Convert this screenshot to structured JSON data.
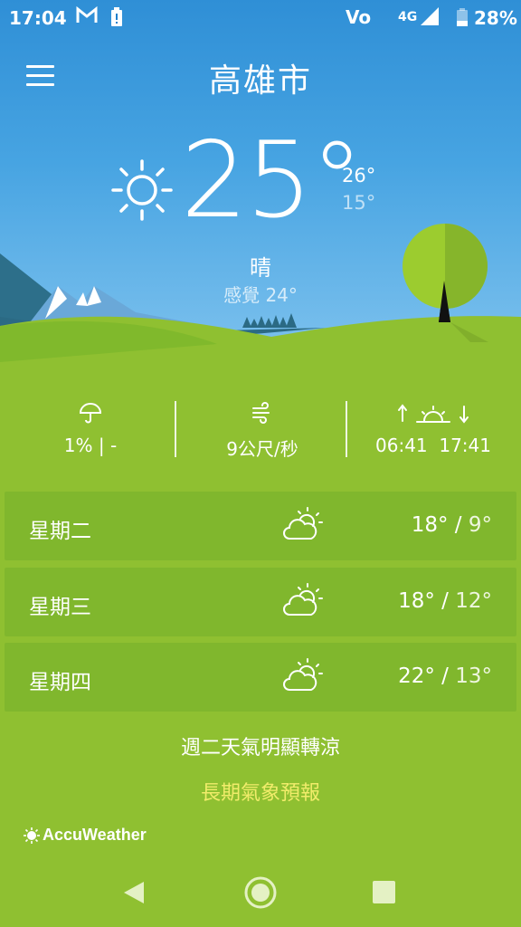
{
  "status_bar": {
    "time": "17:04",
    "mail_icon": "gmail-icon",
    "volte": "Vo",
    "network": "4G",
    "battery_percent": "28%"
  },
  "header": {
    "city": "高雄市",
    "menu_icon": "menu-icon"
  },
  "current": {
    "temperature": "25°",
    "high": "26°",
    "low": "15°",
    "condition": "晴",
    "feels_like": "感覺 24°",
    "icon": "sun-icon"
  },
  "details": {
    "precipitation": "1% | -",
    "wind": "9公尺/秒",
    "sunrise": "06:41",
    "sunset": "17:41"
  },
  "forecast": [
    {
      "day": "星期二",
      "high": "18°",
      "low": "9°",
      "icon": "partly-cloudy-icon"
    },
    {
      "day": "星期三",
      "high": "18°",
      "low": "12°",
      "icon": "partly-cloudy-icon"
    },
    {
      "day": "星期四",
      "high": "22°",
      "low": "13°",
      "icon": "partly-cloudy-icon"
    }
  ],
  "summary": "週二天氣明顯轉涼",
  "long_range_link": "長期氣象預報",
  "brand": "AccuWeather",
  "colors": {
    "sky_top": "#2f8fd6",
    "grass": "#8fc031",
    "row_bg": "#80b72d",
    "link": "#f1ec6a"
  }
}
